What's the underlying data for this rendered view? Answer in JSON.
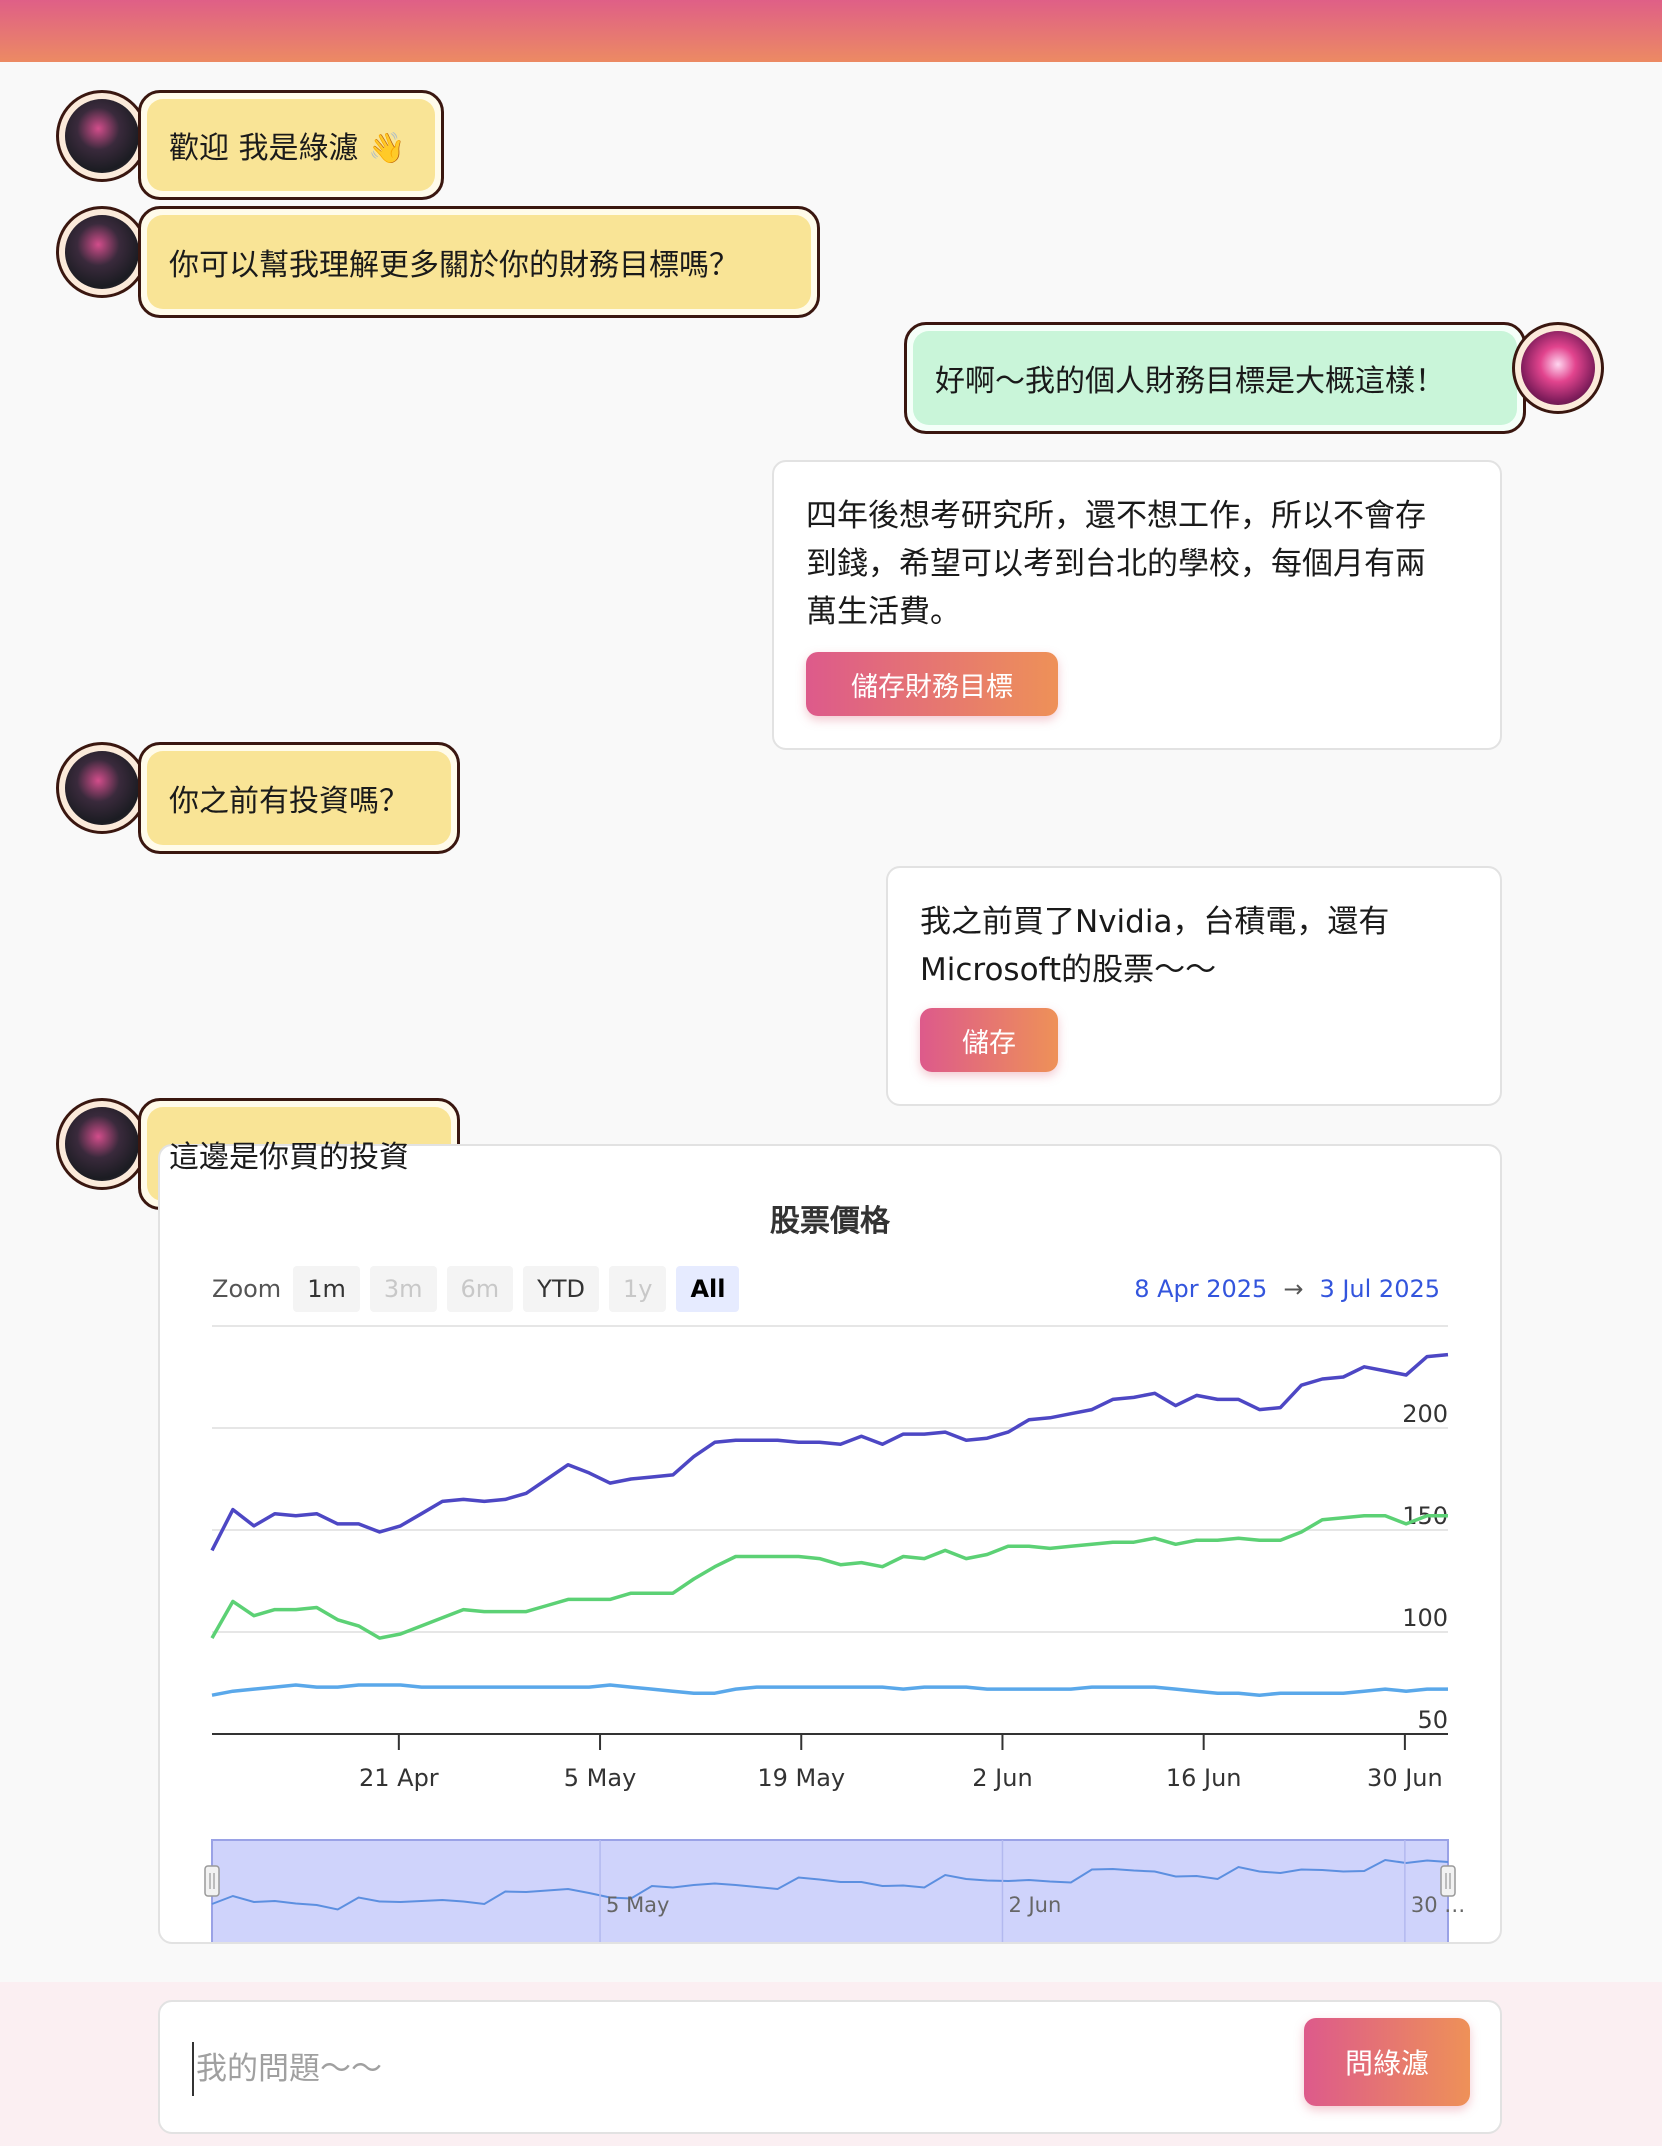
{
  "colors": {
    "accent_start": "#dd5a8b",
    "accent_end": "#ee9158",
    "bot_bubble": "#f9e496",
    "user_bubble": "#c9f5d9",
    "range_text": "#3355dd"
  },
  "messages": {
    "bot_1": "歡迎 我是綠濾 👋",
    "bot_2": "你可以幫我理解更多關於你的財務目標嗎？",
    "user_1": "好啊～我的個人財務目標是大概這樣！",
    "card_1_lines": [
      "四年後想考研究所，還不想工作，所以不會存",
      "到錢，希望可以考到台北的學校，每個月有兩",
      "萬生活費。"
    ],
    "card_1_button": "儲存財務目標",
    "bot_3": "你之前有投資嗎？",
    "card_2_lines": [
      "我之前買了Nvidia，台積電，還有",
      "Microsoft的股票～～"
    ],
    "card_2_button": "儲存",
    "bot_4": "這邊是你買的投資"
  },
  "chart_ui": {
    "zoom_label": "Zoom",
    "zoom_buttons": [
      {
        "label": "1m",
        "state": "enabled"
      },
      {
        "label": "3m",
        "state": "disabled"
      },
      {
        "label": "6m",
        "state": "disabled"
      },
      {
        "label": "YTD",
        "state": "enabled"
      },
      {
        "label": "1y",
        "state": "disabled"
      },
      {
        "label": "All",
        "state": "selected"
      }
    ],
    "range_from": "8 Apr 2025",
    "range_arrow": "→",
    "range_to": "3 Jul 2025"
  },
  "chart_data": {
    "type": "line",
    "title": "股票價格",
    "x_start": "2025-04-08",
    "x_end": "2025-07-03",
    "xtick_labels": [
      "21 Apr",
      "5 May",
      "19 May",
      "2 Jun",
      "16 Jun",
      "30 Jun"
    ],
    "ytick_labels": [
      "50",
      "100",
      "150",
      "200"
    ],
    "ylim": [
      50,
      250
    ],
    "grid": true,
    "navigator_labels": [
      "5 May",
      "2 Jun",
      "30 …"
    ],
    "series": [
      {
        "color": "#4d47c4",
        "values": [
          140,
          160,
          152,
          158,
          157,
          158,
          153,
          153,
          149,
          152,
          158,
          164,
          165,
          164,
          165,
          168,
          175,
          182,
          178,
          173,
          175,
          176,
          177,
          186,
          193,
          194,
          194,
          194,
          193,
          193,
          192,
          196,
          192,
          197,
          197,
          198,
          194,
          195,
          198,
          204,
          205,
          207,
          209,
          214,
          215,
          217,
          211,
          216,
          214,
          214,
          209,
          210,
          221,
          224,
          225,
          230,
          228,
          226,
          235,
          236
        ]
      },
      {
        "color": "#5cd175",
        "values": [
          97,
          115,
          108,
          111,
          111,
          112,
          106,
          103,
          97,
          99,
          103,
          107,
          111,
          110,
          110,
          110,
          113,
          116,
          116,
          116,
          119,
          119,
          119,
          126,
          132,
          137,
          137,
          137,
          137,
          136,
          133,
          134,
          132,
          137,
          136,
          140,
          136,
          138,
          142,
          142,
          141,
          142,
          143,
          144,
          144,
          146,
          143,
          145,
          145,
          146,
          145,
          145,
          149,
          155,
          156,
          157,
          157,
          153,
          157,
          157
        ]
      },
      {
        "color": "#5aa8ea",
        "values": [
          69,
          71,
          72,
          73,
          74,
          73,
          73,
          74,
          74,
          74,
          73,
          73,
          73,
          73,
          73,
          73,
          73,
          73,
          73,
          74,
          73,
          72,
          71,
          70,
          70,
          72,
          73,
          73,
          73,
          73,
          73,
          73,
          73,
          72,
          73,
          73,
          73,
          72,
          72,
          72,
          72,
          72,
          73,
          73,
          73,
          73,
          72,
          71,
          70,
          70,
          69,
          70,
          70,
          70,
          70,
          71,
          72,
          71,
          72,
          72
        ]
      }
    ]
  },
  "composer": {
    "placeholder": "我的問題～～",
    "send_label": "問綠濾"
  }
}
